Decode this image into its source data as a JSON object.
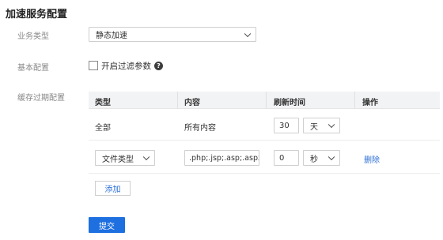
{
  "page": {
    "title": "加速服务配置"
  },
  "form": {
    "business_type": {
      "label": "业务类型",
      "value": "静态加速"
    },
    "basic_config": {
      "label": "基本配置",
      "filter_params_label": "开启过滤参数",
      "filter_params_checked": false,
      "help_icon_glyph": "?"
    },
    "cache_expiry": {
      "label": "缓存过期配置",
      "columns": [
        "类型",
        "内容",
        "刷新时间",
        "操作"
      ],
      "rows": [
        {
          "type": "全部",
          "content": "所有内容",
          "refresh_value": "30",
          "refresh_unit": "天",
          "action": ""
        },
        {
          "type": "文件类型",
          "content": ".php;.jsp;.asp;.aspx",
          "refresh_value": "0",
          "refresh_unit": "秒",
          "action": "删除"
        }
      ],
      "add_button": "添加"
    },
    "submit_button": "提交"
  },
  "colors": {
    "primary": "#1e6fe0",
    "link": "#2b6fd6",
    "table_header_bg": "#f2f3f5"
  },
  "icons": {
    "help": "question-circle-icon",
    "dropdown": "chevron-down-icon"
  }
}
